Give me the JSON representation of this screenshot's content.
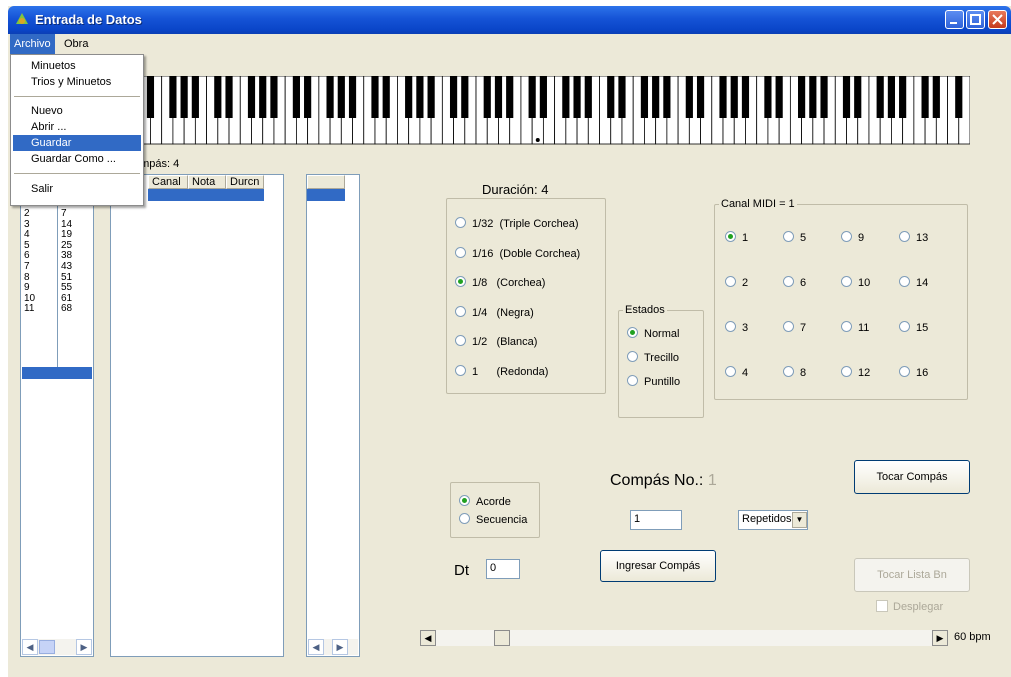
{
  "window": {
    "title": "Entrada de Datos"
  },
  "menu": {
    "archivo": "Archivo",
    "obra": "Obra"
  },
  "archivo_menu": {
    "items": [
      "Minuetos",
      "Trios y Minuetos",
      "Nuevo",
      "Abrir ...",
      "Guardar",
      "Guardar Como ...",
      "Salir"
    ],
    "highlighted": "Guardar"
  },
  "compas_label": "ompás: 4",
  "list_left": {
    "rows": [
      [
        "2",
        "7"
      ],
      [
        "3",
        "14"
      ],
      [
        "4",
        "19"
      ],
      [
        "5",
        "25"
      ],
      [
        "6",
        "38"
      ],
      [
        "7",
        "43"
      ],
      [
        "8",
        "51"
      ],
      [
        "9",
        "55"
      ],
      [
        "10",
        "61"
      ],
      [
        "11",
        "68"
      ]
    ]
  },
  "note_table": {
    "columns": [
      "Canal",
      "Nota",
      "Durcn"
    ]
  },
  "duracion": {
    "label": "Duración: 4",
    "options": [
      "1/32  (Triple Corchea)",
      "1/16  (Doble Corchea)",
      "1/8   (Corchea)",
      "1/4   (Negra)",
      "1/2   (Blanca)",
      "1      (Redonda)"
    ],
    "selected": "1/8   (Corchea)"
  },
  "estados": {
    "legend": "Estados",
    "options": [
      "Normal",
      "Trecillo",
      "Puntillo"
    ],
    "selected": "Normal"
  },
  "canal_midi": {
    "legend": "Canal MIDI = 1",
    "channels": [
      "1",
      "5",
      "9",
      "13",
      "2",
      "6",
      "10",
      "14",
      "3",
      "7",
      "11",
      "15",
      "4",
      "8",
      "12",
      "16"
    ],
    "selected": "1"
  },
  "modo": {
    "options": [
      "Acorde",
      "Secuencia"
    ],
    "selected": "Acorde"
  },
  "compas_no": {
    "label": "Compás No.:",
    "value": "1"
  },
  "compas_input": "1",
  "repetidos": "Repetidos",
  "dt": {
    "label": "Dt",
    "value": "0"
  },
  "buttons": {
    "tocar_compas": "Tocar Compás",
    "ingresar_compas": "Ingresar Compás",
    "tocar_lista": "Tocar Lista Bn"
  },
  "desplegar": "Desplegar",
  "tempo": "60 bpm",
  "colors": {
    "title_blue": "#0a45c8",
    "highlight": "#316ac5",
    "panel": "#ece9d8"
  }
}
